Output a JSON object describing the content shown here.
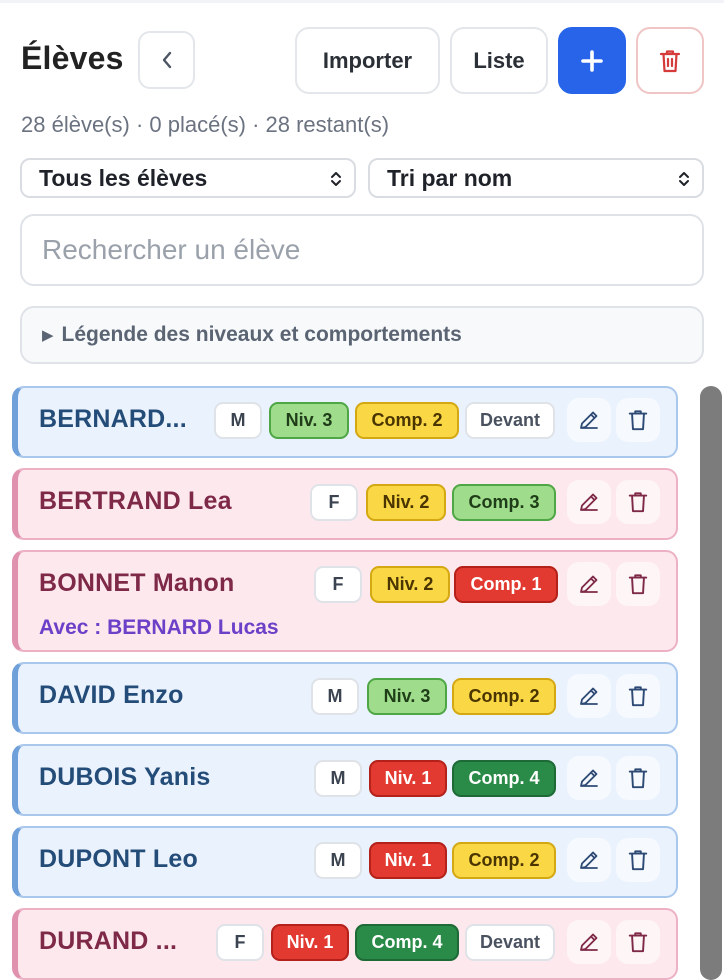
{
  "header": {
    "title": "Élèves",
    "import_label": "Importer",
    "list_label": "Liste",
    "add_label": "+",
    "summary": "28 élève(s) · 0 placé(s) · 28 restant(s)"
  },
  "filters": {
    "student_filter": "Tous les élèves",
    "sort": "Tri par nom"
  },
  "search": {
    "placeholder": "Rechercher un élève"
  },
  "legend": {
    "label": "Légende des niveaux et comportements"
  },
  "colors": {
    "accent": "#2764ea",
    "boy_card": "#eaf2fd",
    "girl_card": "#fde8ee",
    "danger": "#e23a30"
  },
  "students": [
    {
      "name": "BERNARD...",
      "gender": "M",
      "level": "Niv. 3",
      "behavior": "Comp. 2",
      "placement": "Devant"
    },
    {
      "name": "BERTRAND Lea",
      "gender": "F",
      "level": "Niv. 2",
      "behavior": "Comp. 3"
    },
    {
      "name": "BONNET Manon",
      "gender": "F",
      "level": "Niv. 2",
      "behavior": "Comp. 1",
      "with": "Avec : BERNARD Lucas"
    },
    {
      "name": "DAVID Enzo",
      "gender": "M",
      "level": "Niv. 3",
      "behavior": "Comp. 2"
    },
    {
      "name": "DUBOIS Yanis",
      "gender": "M",
      "level": "Niv. 1",
      "behavior": "Comp. 4"
    },
    {
      "name": "DUPONT Leo",
      "gender": "M",
      "level": "Niv. 1",
      "behavior": "Comp. 2"
    },
    {
      "name": "DURAND ...",
      "gender": "F",
      "level": "Niv. 1",
      "behavior": "Comp. 4",
      "placement": "Devant"
    }
  ]
}
